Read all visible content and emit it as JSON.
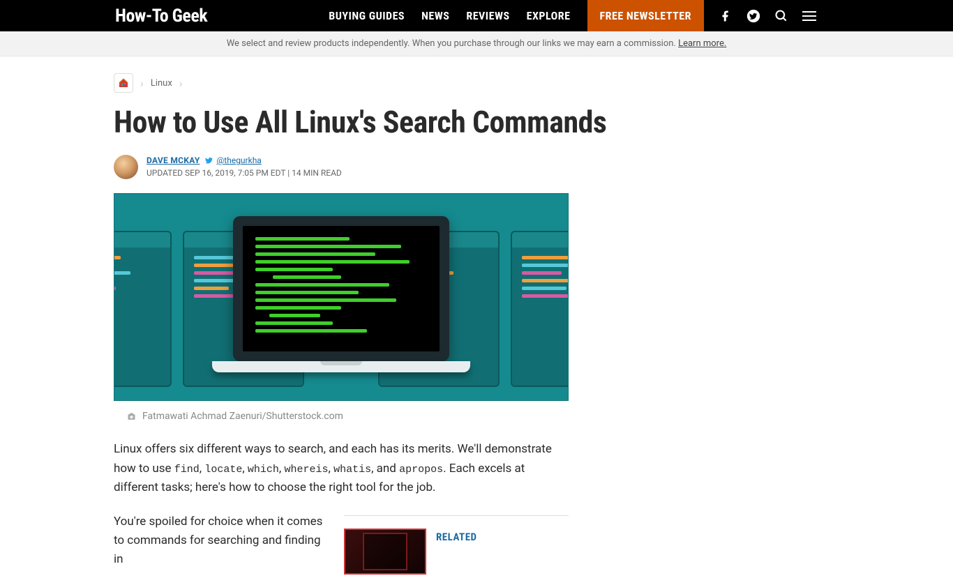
{
  "header": {
    "logo": "How-To Geek",
    "nav": [
      "BUYING GUIDES",
      "NEWS",
      "REVIEWS",
      "EXPLORE"
    ],
    "newsletter": "FREE NEWSLETTER"
  },
  "affiliate": {
    "text": "We select and review products independently. When you purchase through our links we may earn a commission. ",
    "link": "Learn more."
  },
  "breadcrumb": {
    "category": "Linux"
  },
  "article": {
    "title": "How to Use All Linux's Search Commands",
    "author": "DAVE MCKAY",
    "twitter": "@thegurkha",
    "meta": "UPDATED SEP 16, 2019, 7:05 PM EDT | 14 MIN READ",
    "image_credit": "Fatmawati Achmad Zaenuri/Shutterstock.com",
    "intro_pre": "Linux offers six different ways to search, and each has its merits. We'll demonstrate how to use ",
    "cmd1": "find",
    "c1": ", ",
    "cmd2": "locate",
    "c2": ", ",
    "cmd3": "which",
    "c3": ", ",
    "cmd4": "whereis",
    "c4": ", ",
    "cmd5": "whatis",
    "c5": ", and ",
    "cmd6": "apropos",
    "intro_post": ". Each excels at different tasks; here's how to choose the right tool for the job.",
    "para2": "You're spoiled for choice when it comes to commands for searching and finding in",
    "related_label": "RELATED"
  }
}
